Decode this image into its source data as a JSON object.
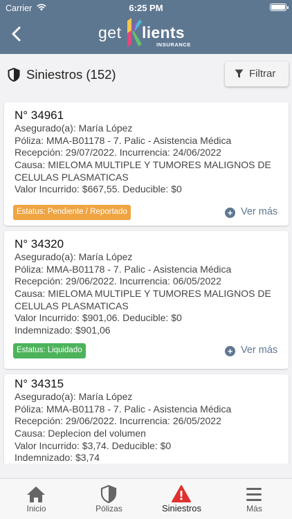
{
  "status_bar": {
    "carrier": "Carrier",
    "time": "6:25 PM"
  },
  "header": {
    "logo_get": "get",
    "logo_lients": "lients",
    "logo_sub": "INSURANCE",
    "back_icon": "chevron-left-icon"
  },
  "page": {
    "title": "Siniestros (152)",
    "title_icon": "shield-icon",
    "filter_label": "Filtrar",
    "filter_icon": "funnel-icon"
  },
  "claims": [
    {
      "number": "N° 34961",
      "lines": [
        "Asegurado(a): María López",
        "Póliza: MMA-B01178 - 7. Palic - Asistencia Médica",
        "Recepción: 29/07/2022. Incurrencia: 24/06/2022",
        "Causa: MIELOMA MULTIPLE Y TUMORES MALIGNOS DE",
        "CELULAS PLASMATICAS",
        "Valor Incurrido: $667,55. Deducible: $0"
      ],
      "status": "Estatus: Pendiente / Reportado",
      "status_color": "#f0a442",
      "more_label": "Ver más"
    },
    {
      "number": "N° 34320",
      "lines": [
        "Asegurado(a): María López",
        "Póliza: MMA-B01178 - 7. Palic - Asistencia Médica",
        "Recepción: 29/06/2022. Incurrencia: 06/05/2022",
        "Causa: MIELOMA MULTIPLE Y TUMORES MALIGNOS DE",
        "CELULAS PLASMATICAS",
        "Valor Incurrido: $901,06. Deducible: $0",
        "Indemnizado: $901,06"
      ],
      "status": "Estatus: Liquidado",
      "status_color": "#4cb35a",
      "more_label": "Ver más"
    },
    {
      "number": "N° 34315",
      "lines": [
        "Asegurado(a): María López",
        "Póliza: MMA-B01178 - 7. Palic - Asistencia Médica",
        "Recepción: 29/06/2022. Incurrencia: 26/05/2022",
        "Causa: Deplecion del volumen",
        "Valor Incurrido: $3,74. Deducible: $0",
        "Indemnizado: $3,74"
      ]
    }
  ],
  "tabs": [
    {
      "label": "Inicio",
      "icon": "home-icon"
    },
    {
      "label": "Pólizas",
      "icon": "shield-icon"
    },
    {
      "label": "Siniestros",
      "icon": "warning-icon",
      "active": true
    },
    {
      "label": "Más",
      "icon": "menu-icon"
    }
  ],
  "colors": {
    "primary": "#5e7791",
    "pending": "#f0a442",
    "settled": "#4cb35a",
    "alert": "#e0312e"
  }
}
